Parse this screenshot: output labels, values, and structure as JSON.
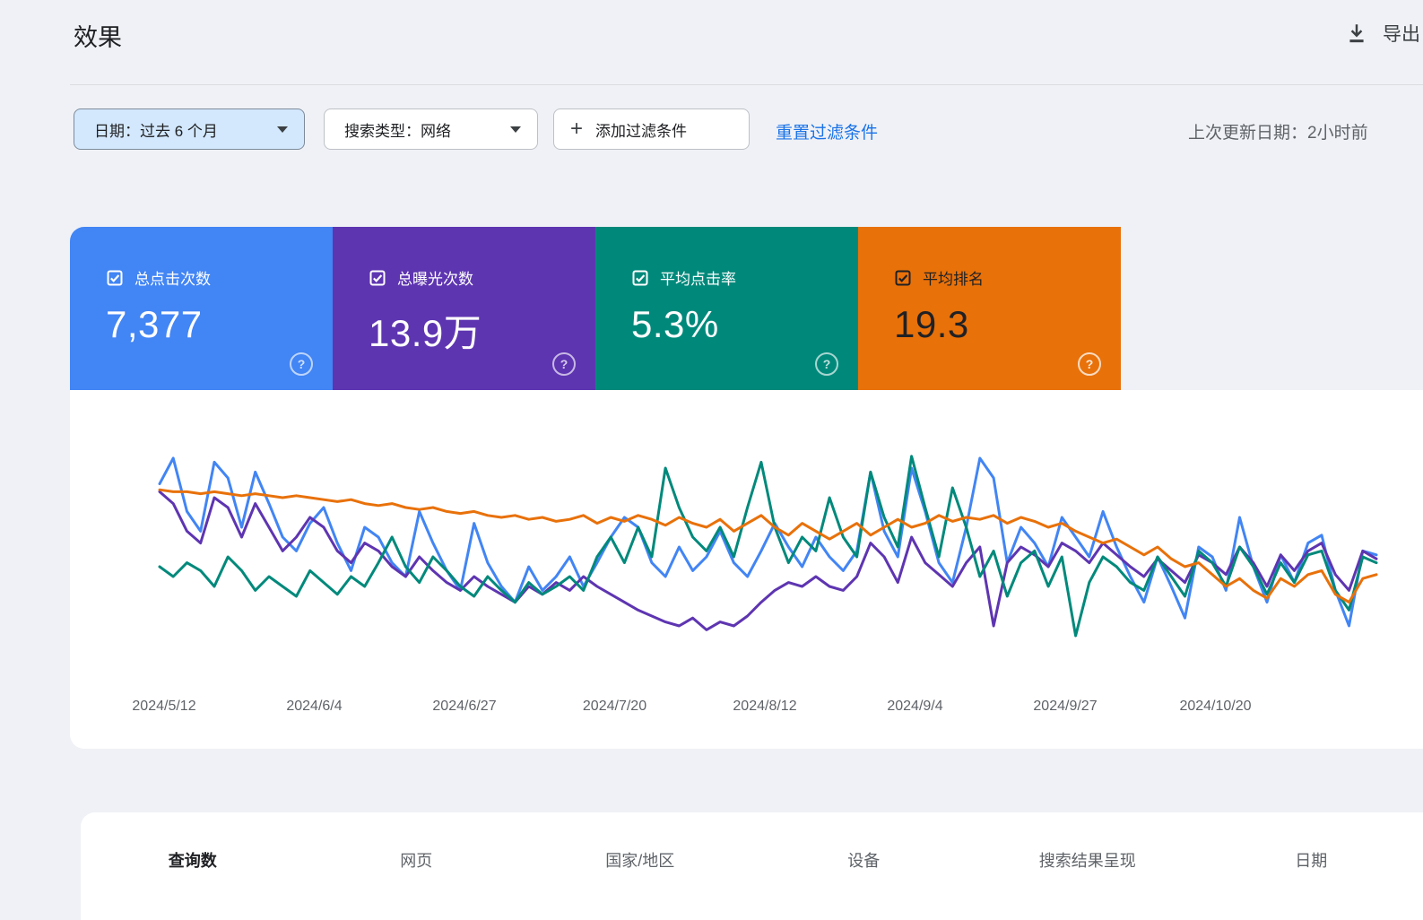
{
  "page": {
    "title": "效果"
  },
  "header": {
    "export_label": "导出"
  },
  "toolbar": {
    "date_filter": "日期：过去 6 个月",
    "search_type_filter": "搜索类型：网络",
    "add_filter_label": "添加过滤条件",
    "reset_filters_label": "重置过滤条件",
    "last_updated": "上次更新日期：2小时前"
  },
  "metric_cards": [
    {
      "label": "总点击次数",
      "value": "7,377",
      "color": "#4285f4",
      "text_color": "#ffffff",
      "checked": true
    },
    {
      "label": "总曝光次数",
      "value": "13.9万",
      "color": "#5e35b1",
      "text_color": "#ffffff",
      "checked": true
    },
    {
      "label": "平均点击率",
      "value": "5.3%",
      "color": "#00897b",
      "text_color": "#ffffff",
      "checked": true
    },
    {
      "label": "平均排名",
      "value": "19.3",
      "color": "#e8710a",
      "text_color": "#202124",
      "checked": true
    }
  ],
  "tabs": [
    {
      "label": "查询数",
      "active": true
    },
    {
      "label": "网页",
      "active": false
    },
    {
      "label": "国家/地区",
      "active": false
    },
    {
      "label": "设备",
      "active": false
    },
    {
      "label": "搜索结果呈现",
      "active": false
    },
    {
      "label": "日期",
      "active": false
    }
  ],
  "chart_data": {
    "type": "line",
    "title": "",
    "x_labels": [
      "2024/5/12",
      "2024/6/4",
      "2024/6/27",
      "2024/7/20",
      "2024/8/12",
      "2024/9/4",
      "2024/9/27",
      "2024/10/20"
    ],
    "x_range": [
      "2024/5/11",
      "2024/11/8"
    ],
    "grid": false,
    "legend_position": "none",
    "y_axis_shown": false,
    "y_unit": "percent-of-plot-height (0-100, daily values normalized per series)",
    "series": [
      {
        "name": "总点击次数",
        "color": "#4285f4",
        "values": [
          82,
          95,
          68,
          58,
          93,
          85,
          60,
          88,
          72,
          55,
          48,
          62,
          70,
          52,
          38,
          60,
          55,
          42,
          35,
          68,
          52,
          38,
          28,
          62,
          42,
          30,
          22,
          40,
          28,
          35,
          45,
          30,
          42,
          55,
          65,
          60,
          42,
          35,
          50,
          38,
          45,
          58,
          42,
          35,
          48,
          62,
          50,
          40,
          55,
          45,
          38,
          48,
          88,
          58,
          45,
          90,
          68,
          42,
          32,
          60,
          95,
          85,
          42,
          60,
          52,
          40,
          65,
          55,
          45,
          68,
          50,
          35,
          22,
          45,
          30,
          14,
          50,
          45,
          28,
          65,
          40,
          22,
          46,
          32,
          52,
          56,
          28,
          10,
          48,
          46
        ]
      },
      {
        "name": "总曝光次数",
        "color": "#5e35b1",
        "values": [
          78,
          72,
          58,
          52,
          75,
          70,
          55,
          72,
          60,
          48,
          55,
          65,
          60,
          48,
          42,
          52,
          48,
          40,
          35,
          45,
          38,
          32,
          28,
          35,
          30,
          26,
          22,
          30,
          26,
          32,
          28,
          35,
          30,
          26,
          22,
          18,
          15,
          12,
          10,
          14,
          8,
          12,
          10,
          15,
          22,
          28,
          32,
          30,
          35,
          30,
          28,
          35,
          52,
          45,
          32,
          55,
          42,
          36,
          30,
          42,
          50,
          10,
          42,
          50,
          46,
          40,
          52,
          48,
          42,
          52,
          46,
          40,
          35,
          44,
          38,
          32,
          46,
          42,
          36,
          50,
          42,
          30,
          46,
          38,
          48,
          52,
          36,
          28,
          48,
          44
        ]
      },
      {
        "name": "平均点击率",
        "color": "#00897b",
        "values": [
          40,
          35,
          42,
          38,
          30,
          45,
          38,
          28,
          35,
          30,
          25,
          38,
          32,
          26,
          35,
          30,
          42,
          55,
          40,
          32,
          45,
          38,
          30,
          25,
          35,
          28,
          22,
          32,
          26,
          30,
          35,
          28,
          45,
          55,
          42,
          60,
          45,
          90,
          70,
          55,
          48,
          60,
          45,
          70,
          93,
          60,
          42,
          55,
          48,
          75,
          55,
          45,
          88,
          65,
          50,
          96,
          70,
          45,
          80,
          60,
          35,
          48,
          25,
          42,
          48,
          30,
          45,
          5,
          32,
          45,
          40,
          32,
          28,
          45,
          35,
          25,
          48,
          42,
          30,
          50,
          40,
          26,
          42,
          32,
          46,
          48,
          28,
          18,
          45,
          42
        ]
      },
      {
        "name": "平均排名",
        "color": "#e8710a",
        "values": [
          79,
          78,
          78,
          77,
          78,
          77,
          76,
          77,
          76,
          75,
          76,
          75,
          74,
          73,
          74,
          72,
          71,
          72,
          70,
          69,
          70,
          68,
          67,
          68,
          66,
          65,
          66,
          64,
          65,
          63,
          64,
          66,
          62,
          65,
          63,
          66,
          64,
          61,
          65,
          62,
          60,
          64,
          58,
          62,
          66,
          60,
          56,
          62,
          58,
          54,
          58,
          62,
          56,
          60,
          64,
          60,
          62,
          66,
          63,
          65,
          64,
          66,
          62,
          65,
          63,
          60,
          62,
          58,
          55,
          52,
          54,
          50,
          46,
          50,
          44,
          40,
          42,
          36,
          30,
          34,
          28,
          24,
          34,
          30,
          36,
          38,
          26,
          22,
          34,
          36
        ]
      }
    ]
  }
}
